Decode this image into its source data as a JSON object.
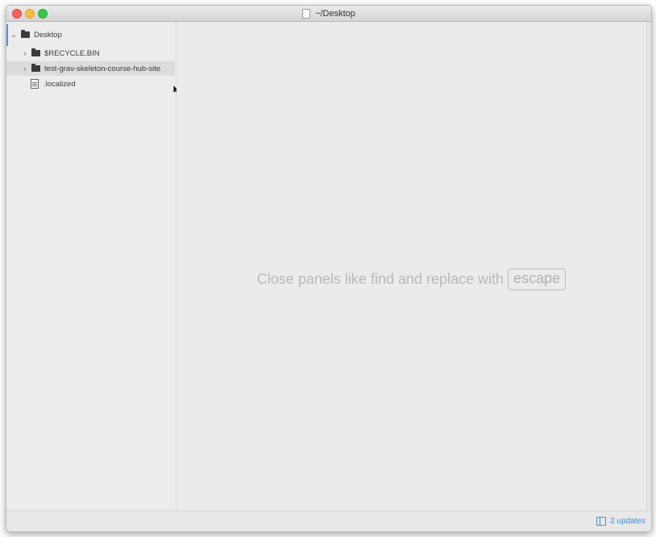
{
  "window": {
    "title": "~/Desktop"
  },
  "tree": {
    "root": {
      "label": "Desktop",
      "expanded": true
    },
    "items": [
      {
        "label": "$RECYCLE.BIN",
        "type": "folder",
        "expanded": false
      },
      {
        "label": "test-grav-skeleton-course-hub-site",
        "type": "folder",
        "expanded": false,
        "hovered": true
      },
      {
        "label": ".localized",
        "type": "file"
      }
    ]
  },
  "main": {
    "hint_text": "Close panels like find and replace with",
    "hint_key": "escape"
  },
  "statusbar": {
    "updates_label": "2 updates"
  },
  "colors": {
    "accent": "#3d8fe0",
    "selection_indicator": "#5c8fe6"
  }
}
